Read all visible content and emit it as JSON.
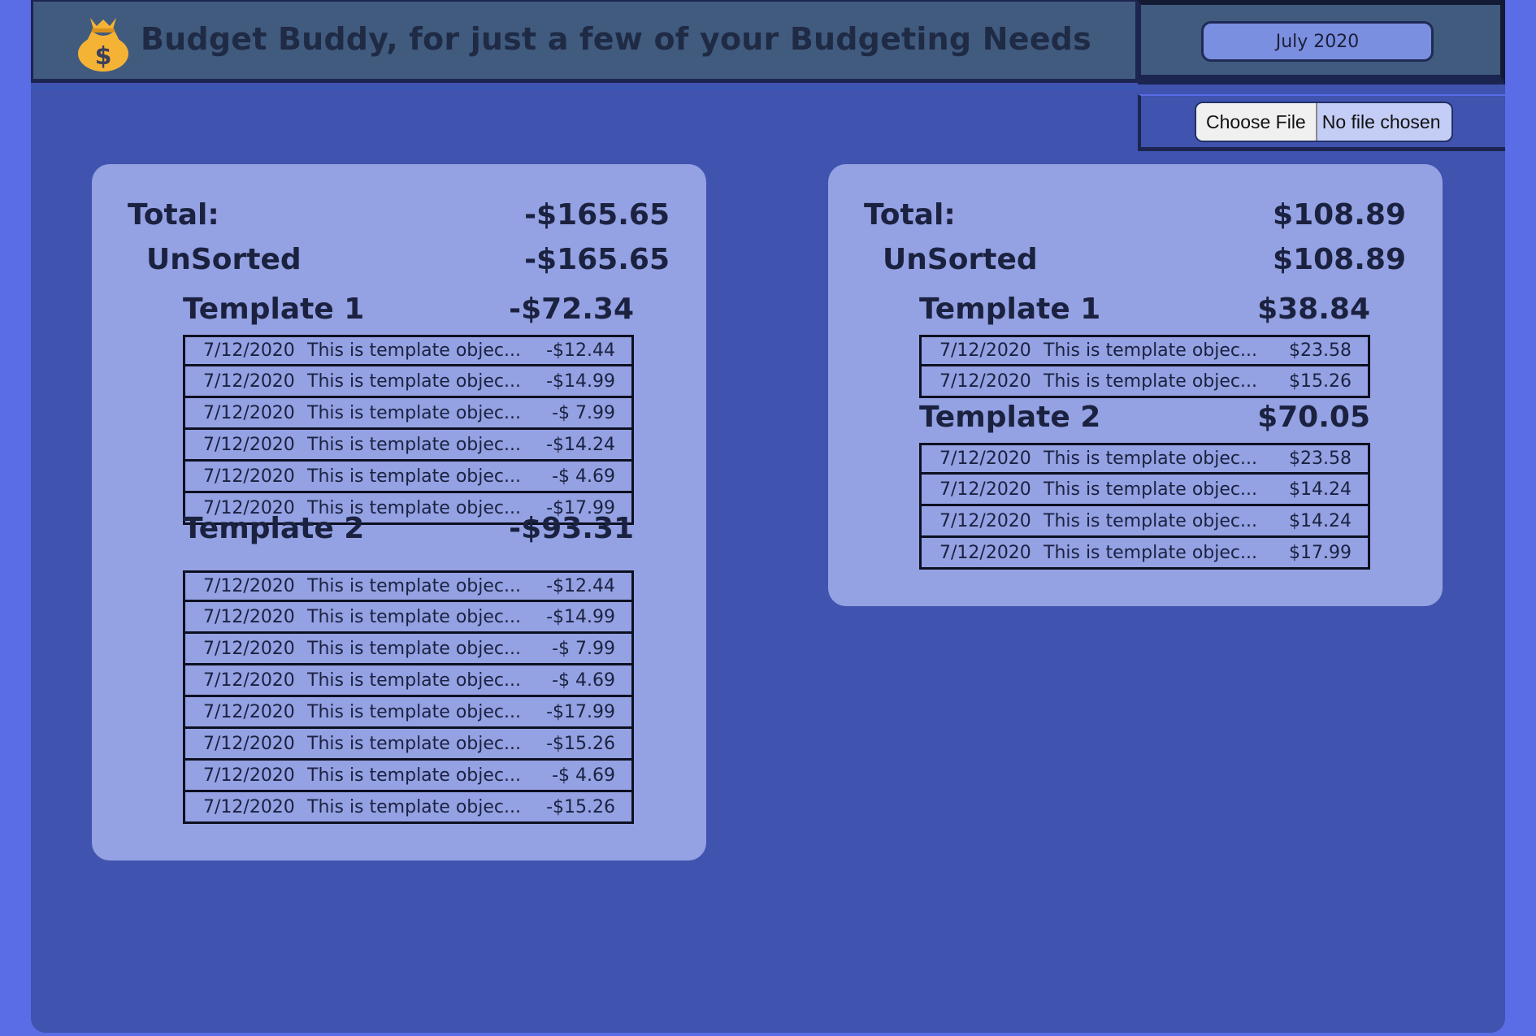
{
  "header": {
    "title": "Budget Buddy, for just a few of your Budgeting Needs",
    "month": "July 2020",
    "logo_icon": "money-bag-icon"
  },
  "file_input": {
    "button_label": "Choose File",
    "status": "No file chosen"
  },
  "left_card": {
    "total_label": "Total:",
    "total_value": "-$165.65",
    "unsorted_label": "UnSorted",
    "unsorted_value": "-$165.65",
    "groups": [
      {
        "name": "Template 1",
        "total": "-$72.34",
        "transactions": [
          {
            "date": "7/12/2020",
            "desc": "This is template objec...",
            "amount": "-$12.44"
          },
          {
            "date": "7/12/2020",
            "desc": "This is template objec...",
            "amount": "-$14.99"
          },
          {
            "date": "7/12/2020",
            "desc": "This is template objec...",
            "amount": "-$ 7.99"
          },
          {
            "date": "7/12/2020",
            "desc": "This is template objec...",
            "amount": "-$14.24"
          },
          {
            "date": "7/12/2020",
            "desc": "This is template objec...",
            "amount": "-$ 4.69"
          },
          {
            "date": "7/12/2020",
            "desc": "This is template objec...",
            "amount": "-$17.99"
          }
        ]
      },
      {
        "name": "Template 2",
        "total": "-$93.31",
        "transactions": [
          {
            "date": "7/12/2020",
            "desc": "This is template objec...",
            "amount": "-$12.44"
          },
          {
            "date": "7/12/2020",
            "desc": "This is template objec...",
            "amount": "-$14.99"
          },
          {
            "date": "7/12/2020",
            "desc": "This is template objec...",
            "amount": "-$ 7.99"
          },
          {
            "date": "7/12/2020",
            "desc": "This is template objec...",
            "amount": "-$ 4.69"
          },
          {
            "date": "7/12/2020",
            "desc": "This is template objec...",
            "amount": "-$17.99"
          },
          {
            "date": "7/12/2020",
            "desc": "This is template objec...",
            "amount": "-$15.26"
          },
          {
            "date": "7/12/2020",
            "desc": "This is template objec...",
            "amount": "-$ 4.69"
          },
          {
            "date": "7/12/2020",
            "desc": "This is template objec...",
            "amount": "-$15.26"
          }
        ]
      }
    ]
  },
  "right_card": {
    "total_label": "Total:",
    "total_value": "$108.89",
    "unsorted_label": "UnSorted",
    "unsorted_value": "$108.89",
    "groups": [
      {
        "name": "Template 1",
        "total": "$38.84",
        "transactions": [
          {
            "date": "7/12/2020",
            "desc": "This is template objec...",
            "amount": "$23.58"
          },
          {
            "date": "7/12/2020",
            "desc": "This is template objec...",
            "amount": "$15.26"
          }
        ]
      },
      {
        "name": "Template 2",
        "total": "$70.05",
        "transactions": [
          {
            "date": "7/12/2020",
            "desc": "This is template objec...",
            "amount": "$23.58"
          },
          {
            "date": "7/12/2020",
            "desc": "This is template objec...",
            "amount": "$14.24"
          },
          {
            "date": "7/12/2020",
            "desc": "This is template objec...",
            "amount": "$14.24"
          },
          {
            "date": "7/12/2020",
            "desc": "This is template objec...",
            "amount": "$17.99"
          }
        ]
      }
    ]
  }
}
